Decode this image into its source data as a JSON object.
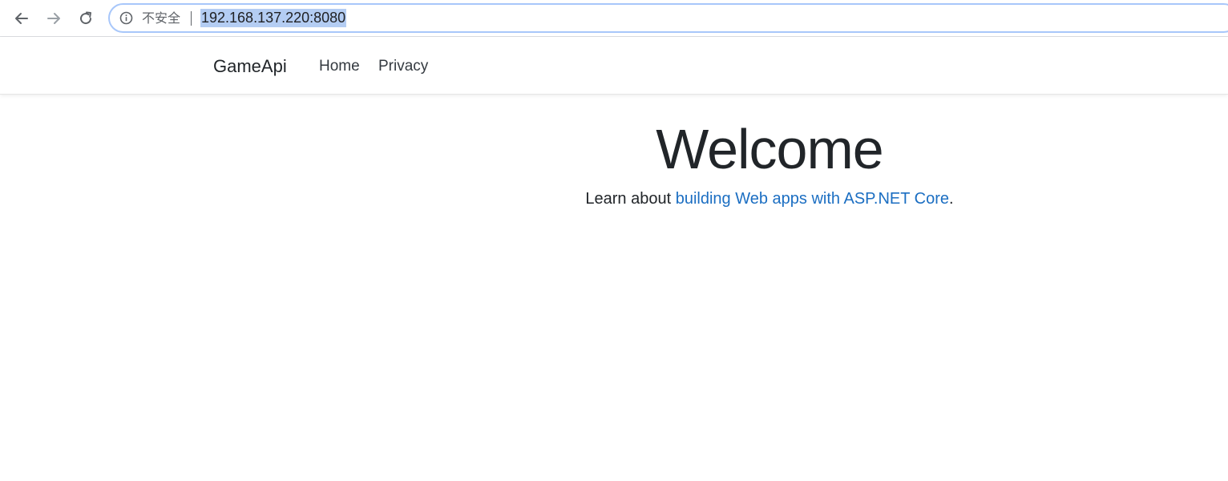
{
  "browser": {
    "security_label": "不安全",
    "url": "192.168.137.220:8080",
    "icons": {
      "back": "back-arrow-icon",
      "forward": "forward-arrow-icon",
      "reload": "reload-icon",
      "info": "info-icon"
    }
  },
  "navbar": {
    "brand": "GameApi",
    "links": [
      {
        "label": "Home"
      },
      {
        "label": "Privacy"
      }
    ]
  },
  "main": {
    "title": "Welcome",
    "learn_prefix": "Learn about ",
    "learn_link": "building Web apps with ASP.NET Core",
    "learn_suffix": "."
  },
  "colors": {
    "link": "#1b6ec2",
    "text": "#212529",
    "url_highlight": "#b4cdf3",
    "omnibox_border": "#a8c7fa"
  }
}
